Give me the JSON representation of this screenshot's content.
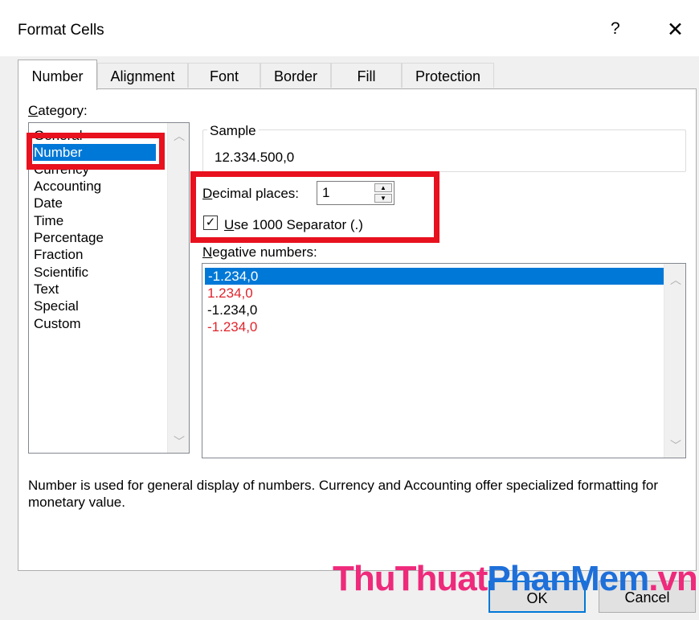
{
  "window": {
    "title": "Format Cells",
    "help": "?",
    "close": "✕"
  },
  "tabs": [
    {
      "label": "Number"
    },
    {
      "label": "Alignment"
    },
    {
      "label": "Font"
    },
    {
      "label": "Border"
    },
    {
      "label": "Fill"
    },
    {
      "label": "Protection"
    }
  ],
  "category": {
    "label_u": "C",
    "label_rest": "ategory:",
    "items": [
      "General",
      "Number",
      "Currency",
      "Accounting",
      "Date",
      "Time",
      "Percentage",
      "Fraction",
      "Scientific",
      "Text",
      "Special",
      "Custom"
    ],
    "selected": "Number"
  },
  "sample": {
    "title": "Sample",
    "value": "12.334.500,0"
  },
  "decimal": {
    "label_u": "D",
    "label_rest": "ecimal places:",
    "value": "1"
  },
  "separator": {
    "checked": true,
    "check_glyph": "✓",
    "label_u": "U",
    "label_rest": "se 1000 Separator (.)"
  },
  "negative": {
    "label_u": "N",
    "label_rest": "egative numbers:",
    "items": [
      {
        "text": "-1.234,0",
        "color": "black"
      },
      {
        "text": "1.234,0",
        "color": "red"
      },
      {
        "text": "-1.234,0",
        "color": "black"
      },
      {
        "text": "-1.234,0",
        "color": "red"
      }
    ]
  },
  "description": "Number is used for general display of numbers.  Currency and Accounting offer specialized formatting for monetary value.",
  "buttons": {
    "ok": "OK",
    "cancel": "Cancel"
  },
  "watermark": {
    "part1": "ThuThuat",
    "part2": "PhanMem",
    "part3": ".vn"
  },
  "colors": {
    "highlight_box": "#e8111e",
    "selection": "#0078d7",
    "negative_red": "#e0242c"
  },
  "icons": {
    "scroll_up": "︿",
    "scroll_down": "﹀",
    "spin_up": "▲",
    "spin_down": "▼"
  }
}
